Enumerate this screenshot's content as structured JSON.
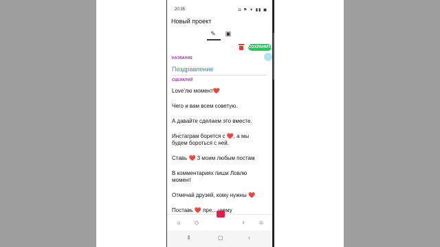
{
  "status": {
    "time": "20:35",
    "icons": "◘ ⚑ ✦ ▮▮ ◼"
  },
  "header": {
    "title": "Новый проект"
  },
  "tabs": [
    {
      "icon": "edit-icon"
    },
    {
      "icon": "profile-icon"
    }
  ],
  "toolbar": {
    "save_label": "СОХРАНИТЬ"
  },
  "fab_label": "···",
  "sections": {
    "name_label": "НАЗВАНИЕ",
    "script_label": "СЦЕНАРИЙ"
  },
  "project": {
    "name": "Поздравление"
  },
  "script_lines": [
    "Love'лю момент❤️",
    "Чего и вам всем советую.",
    "А давайте сделаем это  вместе.",
    "Инстаграм борется с ❤️, а мы будем бороться с ней.",
    "Ставь  ❤️ 3 моим любым постам",
    "В комментариях пиши Ловлю момент",
    "Отмечай друзей, кому нужны ❤️",
    "Поставь ❤️ пре... щему"
  ],
  "bottom_nav": [
    {
      "icon": "home-icon"
    },
    {
      "icon": "tag-icon"
    },
    {
      "icon": "record-icon"
    },
    {
      "icon": "lightbulb-icon"
    },
    {
      "icon": "person-icon"
    }
  ],
  "colors": {
    "accent_green": "#22c55e",
    "accent_purple": "#9c27b0",
    "link_blue": "#3b82f6",
    "heart_red": "#e11d48"
  }
}
